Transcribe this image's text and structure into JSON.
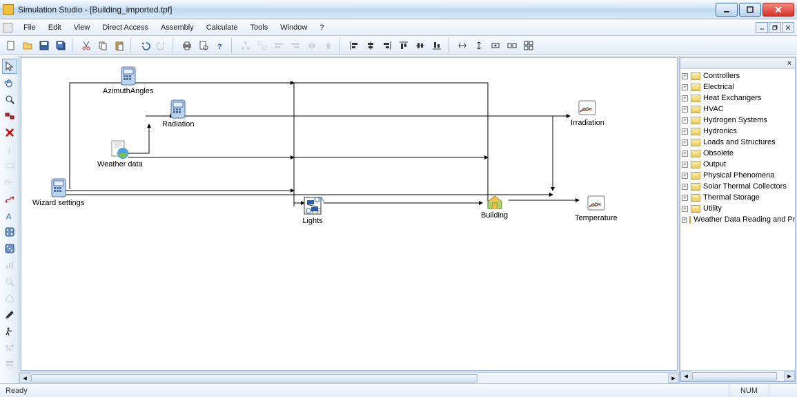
{
  "title": "Simulation Studio - [Building_imported.tpf]",
  "menu": [
    "File",
    "Edit",
    "View",
    "Direct Access",
    "Assembly",
    "Calculate",
    "Tools",
    "Window",
    "?"
  ],
  "status": {
    "left": "Ready",
    "right": "NUM"
  },
  "nodes": {
    "azimuth": "AzimuthAngles",
    "radiation": "Radiation",
    "weather": "Weather data",
    "wizard": "Wizard settings",
    "lights": "Lights",
    "building": "Building",
    "irradiation": "Irradiation",
    "temperature": "Temperature"
  },
  "treeItems": [
    "Controllers",
    "Electrical",
    "Heat Exchangers",
    "HVAC",
    "Hydrogen Systems",
    "Hydronics",
    "Loads and Structures",
    "Obsolete",
    "Output",
    "Physical Phenomena",
    "Solar Thermal Collectors",
    "Thermal Storage",
    "Utility",
    "Weather Data Reading and Processing"
  ]
}
